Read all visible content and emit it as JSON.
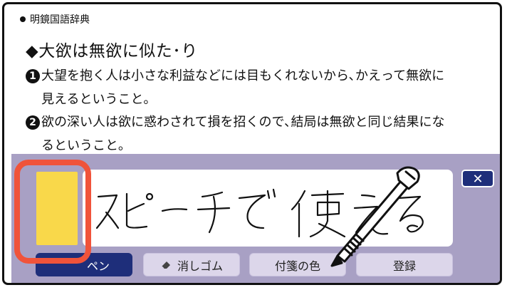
{
  "dictionary": {
    "source": "明鏡国語辞典",
    "headword": "◆大欲は無欲に似た･り",
    "senses": [
      {
        "num": "1",
        "line1": "大望を抱く人は小さな利益などには目もくれないから､かえって無欲に",
        "line2": "見えるということ｡"
      },
      {
        "num": "2",
        "line1": "欲の深い人は欲に惑わされて損を招くので､結局は無欲と同じ結果にな",
        "line2": "るということ｡"
      }
    ]
  },
  "memo": {
    "handwriting": "スピーチで 使える",
    "close_label": "✕",
    "toolbar": {
      "pen_label": "ペン",
      "eraser_label": "消しゴム",
      "color_label": "付箋の色",
      "register_label": "登録"
    },
    "sticky_color": "#f9d84a",
    "highlight_color": "#f0533a",
    "accent_color": "#1e2e7a",
    "panel_color": "#a8a0c4"
  }
}
